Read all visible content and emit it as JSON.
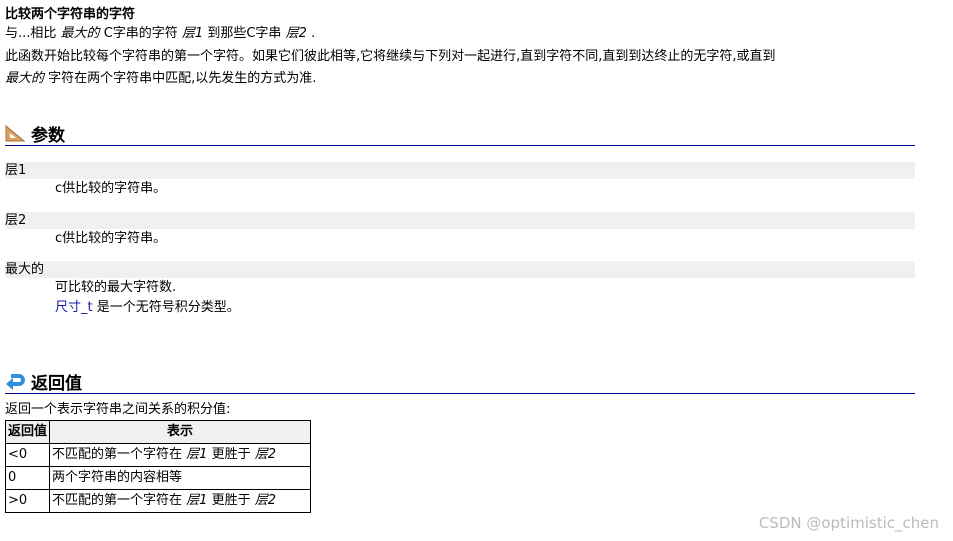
{
  "title": "比较两个字符串的字符",
  "intro": {
    "a": "与...相比",
    "b": "最大的",
    "c": "C字串的字符",
    "d": "层1",
    "e": "到那些C字串",
    "f": "层2",
    "g": "."
  },
  "desc1": "此函数开始比较每个字符串的第一个字符。如果它们彼此相等,它将继续与下列对一起进行,直到字符不同,直到到达终止的无字符,或直到",
  "desc2a": "最大的",
  "desc2b": "字符在两个字符串中匹配,以先发生的方式为准.",
  "params": {
    "heading": "参数",
    "items": [
      {
        "term": "层1",
        "desc": "c供比较的字符串。"
      },
      {
        "term": "层2",
        "desc": "c供比较的字符串。"
      },
      {
        "term": "最大的",
        "desc": "可比较的最大字符数.",
        "link": "尺寸_t",
        "desc2": "是一个无符号积分类型。"
      }
    ]
  },
  "returns": {
    "heading": "返回值",
    "text": "返回一个表示字符串之间关系的积分值:",
    "headers": [
      "返回值",
      "表示"
    ],
    "rows": [
      {
        "v": "<0",
        "a": "不匹配的第一个字符在",
        "b": "层1",
        "c": "更胜于",
        "d": "层2"
      },
      {
        "v": "0",
        "a": "两个字符串的内容相等"
      },
      {
        "v": ">0",
        "a": "不匹配的第一个字符在",
        "b": "层1",
        "c": "更胜于",
        "d": "层2"
      }
    ]
  },
  "watermark": "CSDN @optimistic_chen"
}
